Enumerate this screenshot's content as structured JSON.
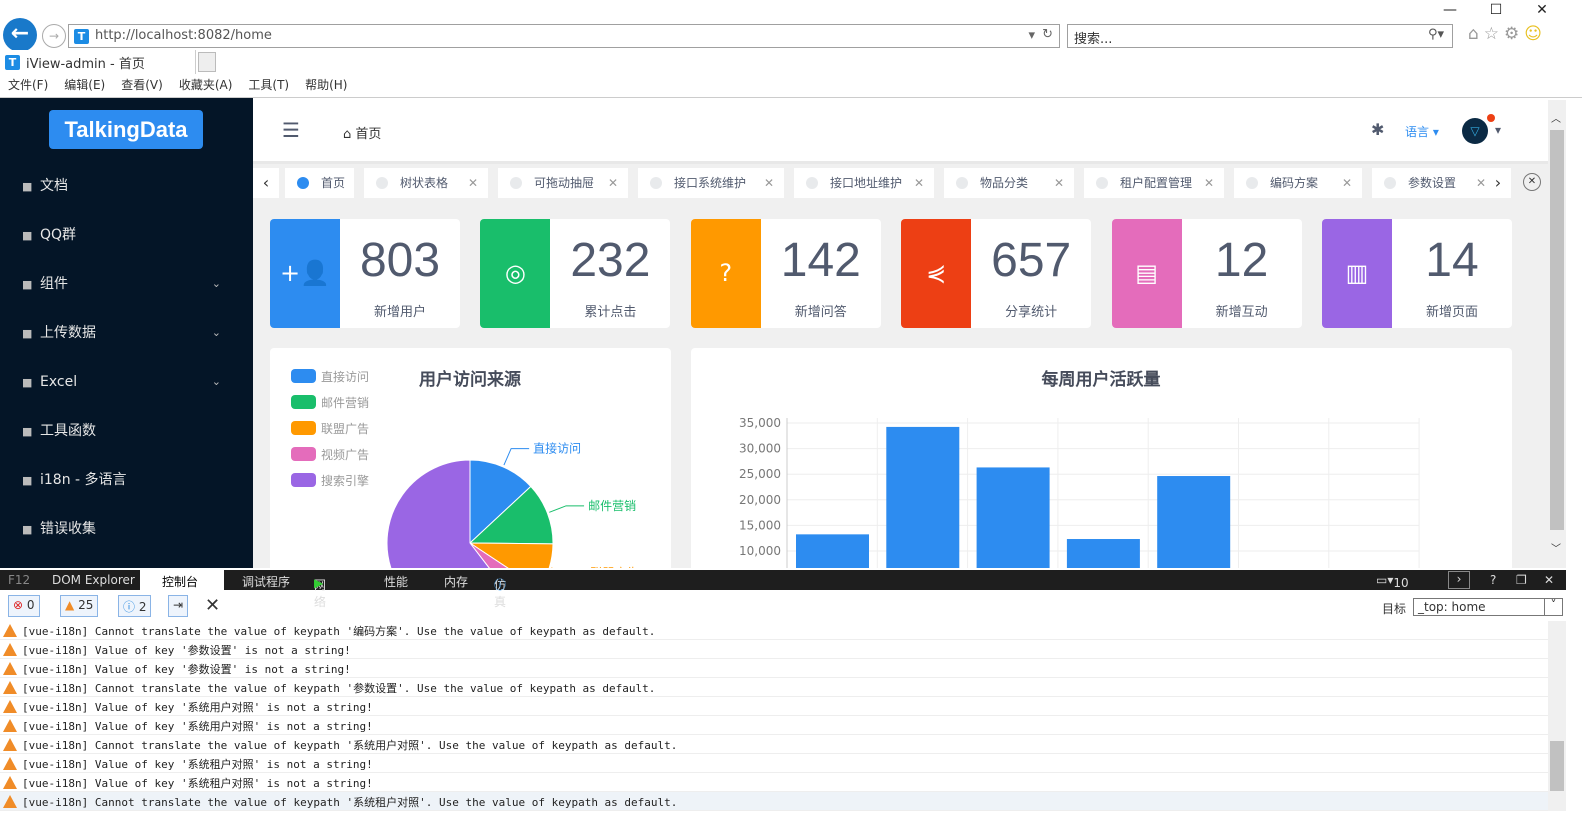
{
  "browser": {
    "url": "http://localhost:8082/home",
    "search_placeholder": "搜索...",
    "tab_title": "iView-admin - 首页",
    "menu": [
      "文件(F)",
      "编辑(E)",
      "查看(V)",
      "收藏夹(A)",
      "工具(T)",
      "帮助(H)"
    ]
  },
  "sidebar": {
    "logo": "TalkingData",
    "items": [
      {
        "label": "文档",
        "icon": "book-icon"
      },
      {
        "label": "QQ群",
        "icon": "bell-icon"
      },
      {
        "label": "组件",
        "icon": "layers-icon",
        "expandable": true
      },
      {
        "label": "上传数据",
        "icon": "cloud-upload-icon",
        "expandable": true
      },
      {
        "label": "Excel",
        "icon": "bar-chart-icon",
        "expandable": true
      },
      {
        "label": "工具函数",
        "icon": "hammer-icon"
      },
      {
        "label": "i18n - 多语言",
        "icon": "globe-icon"
      },
      {
        "label": "错误收集",
        "icon": "bug-icon"
      }
    ]
  },
  "header": {
    "breadcrumb": "首页",
    "language": "语言"
  },
  "tags": [
    "首页",
    "树状表格",
    "可拖动抽屉",
    "接口系统维护",
    "接口地址维护",
    "物品分类",
    "租户配置管理",
    "编码方案",
    "参数设置"
  ],
  "stats": [
    {
      "value": "803",
      "label": "新增用户",
      "color": "#2d8cf0",
      "icon": "add-user-icon"
    },
    {
      "value": "232",
      "label": "累计点击",
      "color": "#19be6b",
      "icon": "locate-icon"
    },
    {
      "value": "142",
      "label": "新增问答",
      "color": "#ff9900",
      "icon": "help-icon"
    },
    {
      "value": "657",
      "label": "分享统计",
      "color": "#ed3f14",
      "icon": "share-icon"
    },
    {
      "value": "12",
      "label": "新增互动",
      "color": "#E46CBB",
      "icon": "chat-icon"
    },
    {
      "value": "14",
      "label": "新增页面",
      "color": "#9A66E4",
      "icon": "map-icon"
    }
  ],
  "chart_data": [
    {
      "type": "pie",
      "title": "用户访问来源",
      "legend": "top-left",
      "categories": [
        "直接访问",
        "邮件营销",
        "联盟广告",
        "视频广告",
        "搜索引擎"
      ],
      "values": [
        335,
        310,
        234,
        135,
        1548
      ],
      "colors": [
        "#2d8cf0",
        "#19be6b",
        "#ff9900",
        "#E46CBB",
        "#9A66E4"
      ]
    },
    {
      "type": "bar",
      "title": "每周用户活跃量",
      "yticks": [
        "10,000",
        "15,000",
        "20,000",
        "25,000",
        "30,000",
        "35,000"
      ],
      "ylim": [
        0,
        35000
      ],
      "values": [
        13253,
        34235,
        26321,
        12340,
        24643
      ],
      "color": "#2d8cf0",
      "grid": true
    }
  ],
  "devtools": {
    "tabs": [
      "F12",
      "DOM Explorer",
      "控制台",
      "调试程序",
      "网络",
      "性能",
      "内存",
      "仿真"
    ],
    "active_tab": "控制台",
    "errors": "0",
    "warnings": "25",
    "info": "2",
    "mode": "10",
    "target_label": "目标",
    "target_value": "_top: home",
    "console": [
      "[vue-i18n] Cannot translate the value of keypath '编码方案'. Use the value of keypath as default.",
      "[vue-i18n] Value of key '参数设置' is not a string!",
      "[vue-i18n] Value of key '参数设置' is not a string!",
      "[vue-i18n] Cannot translate the value of keypath '参数设置'. Use the value of keypath as default.",
      "[vue-i18n] Value of key '系统用户对照' is not a string!",
      "[vue-i18n] Value of key '系统用户对照' is not a string!",
      "[vue-i18n] Cannot translate the value of keypath '系统用户对照'. Use the value of keypath as default.",
      "[vue-i18n] Value of key '系统租户对照' is not a string!",
      "[vue-i18n] Value of key '系统租户对照' is not a string!",
      "[vue-i18n] Cannot translate the value of keypath '系统租户对照'. Use the value of keypath as default."
    ]
  }
}
